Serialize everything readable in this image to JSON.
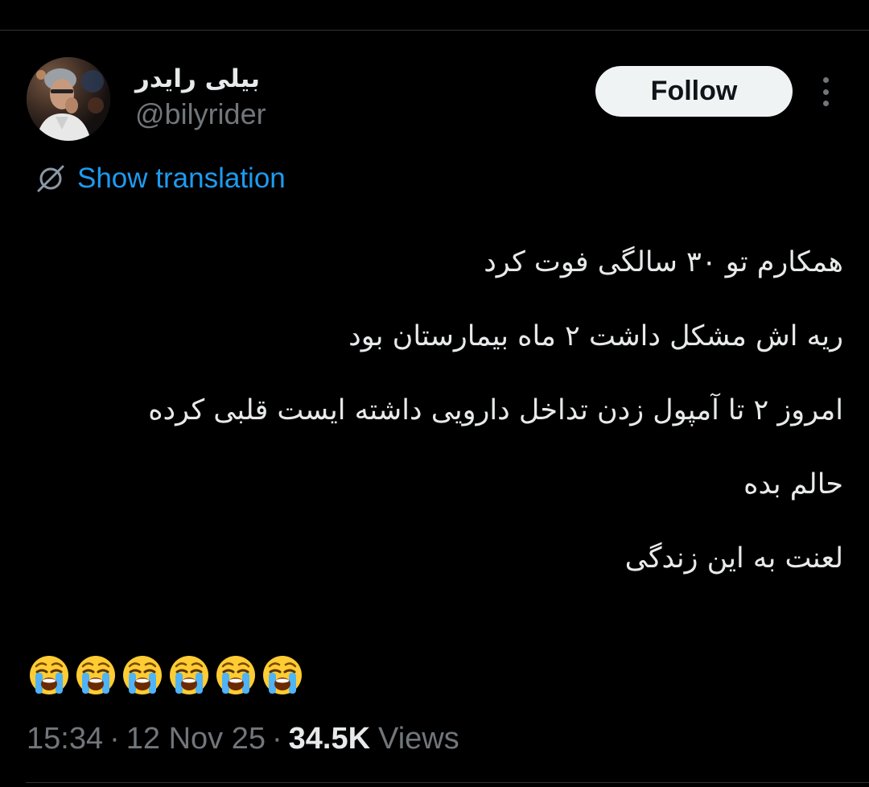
{
  "tweet": {
    "author": {
      "display_name": "بیلی رایدر",
      "handle": "@bilyrider"
    },
    "follow_label": "Follow",
    "show_translation_label": "Show translation",
    "lines": [
      "همکارم تو ۳۰ سالگی فوت کرد",
      "ریه اش مشکل داشت ۲ ماه بیمارستان بود",
      "امروز ۲ تا آمپول زدن تداخل دارویی داشته ایست قلبی کرده",
      "حالم بده",
      "لعنت به این زندگی"
    ],
    "emojis": [
      "😭",
      "😭",
      "😭",
      "😭",
      "😭",
      "😭"
    ],
    "time": "15:34",
    "date": "12 Nov 25",
    "views_count": "34.5K",
    "views_label": "Views"
  },
  "icons": {
    "more": "more-vertical-icon",
    "translate": "globe-slash-icon",
    "emoji": "loudly-crying-face-icon"
  },
  "colors": {
    "background": "#000000",
    "text_primary": "#e7e9ea",
    "text_secondary": "#71767b",
    "link": "#1d9bf0",
    "follow_bg": "#eff3f4",
    "divider": "#2f3336"
  }
}
